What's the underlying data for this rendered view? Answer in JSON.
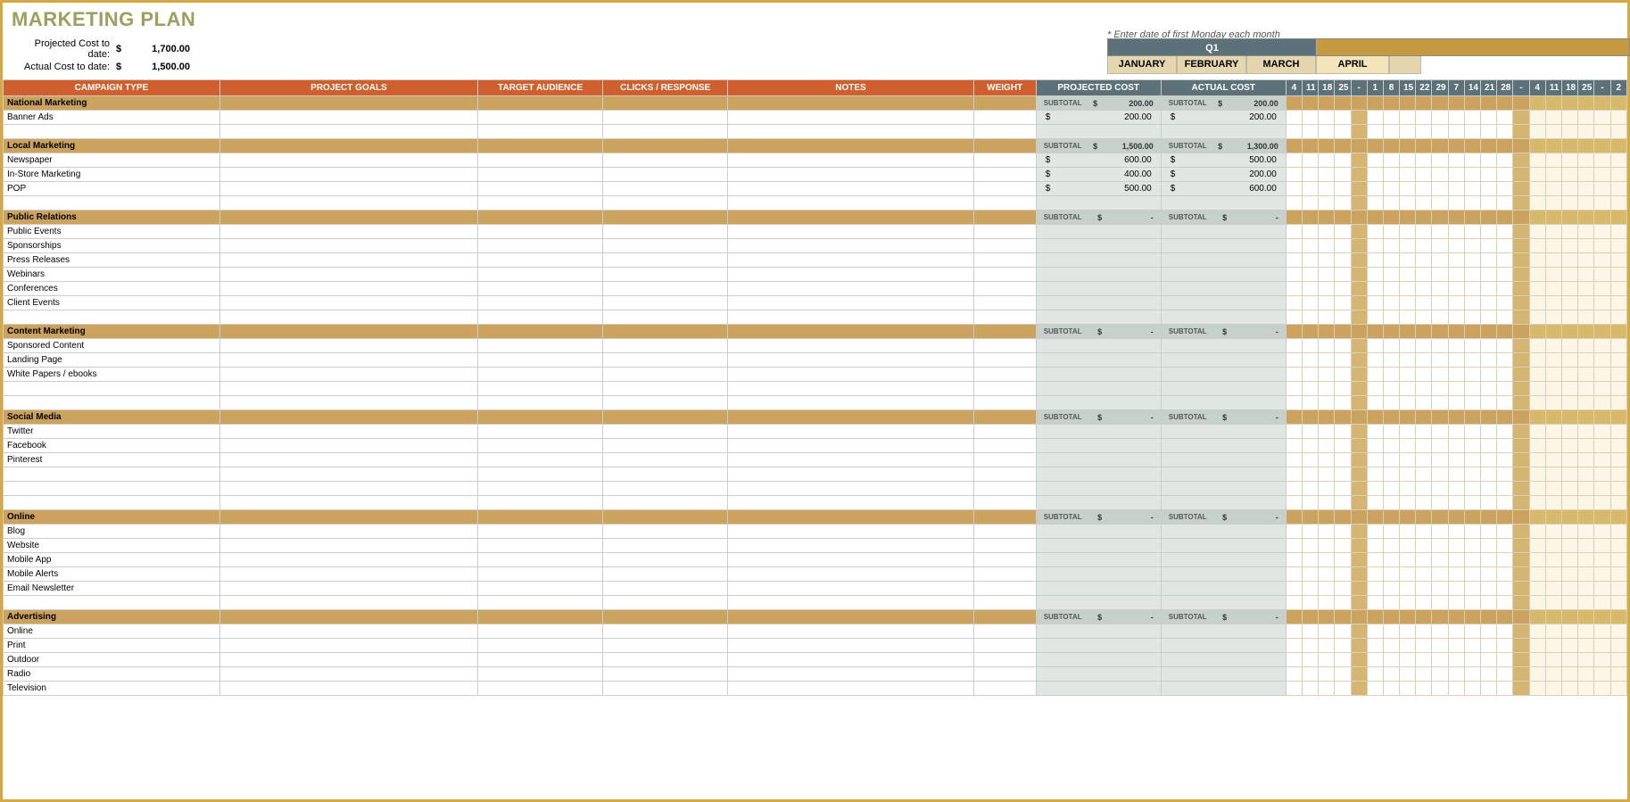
{
  "title": "MARKETING PLAN",
  "meta": {
    "proj_label": "Projected Cost to date:",
    "proj_cur": "$",
    "proj_amt": "1,700.00",
    "act_label": "Actual Cost to date:",
    "act_cur": "$",
    "act_amt": "1,500.00"
  },
  "note": "* Enter date of first Monday each month",
  "calendar": {
    "q1": "Q1",
    "months": [
      "JANUARY",
      "FEBRUARY",
      "MARCH",
      "APRIL"
    ],
    "dates": [
      "4",
      "11",
      "18",
      "25",
      "-",
      "1",
      "8",
      "15",
      "22",
      "29",
      "7",
      "14",
      "21",
      "28",
      "-",
      "4",
      "11",
      "18",
      "25",
      "-",
      "2"
    ]
  },
  "headers": {
    "campaign": "CAMPAIGN TYPE",
    "goals": "PROJECT GOALS",
    "audience": "TARGET AUDIENCE",
    "clicks": "CLICKS / RESPONSE",
    "notes": "NOTES",
    "weight": "WEIGHT",
    "projected": "PROJECTED COST",
    "actual": "ACTUAL COST"
  },
  "subtotal_label": "SUBTOTAL",
  "cur": "$",
  "dash": "-",
  "categories": [
    {
      "name": "National Marketing",
      "proj": "200.00",
      "act": "200.00",
      "items": [
        {
          "name": "Banner Ads",
          "proj": "200.00",
          "act": "200.00"
        },
        {
          "name": ""
        }
      ]
    },
    {
      "name": "Local Marketing",
      "proj": "1,500.00",
      "act": "1,300.00",
      "items": [
        {
          "name": "Newspaper",
          "proj": "600.00",
          "act": "500.00"
        },
        {
          "name": "In-Store Marketing",
          "proj": "400.00",
          "act": "200.00"
        },
        {
          "name": "POP",
          "proj": "500.00",
          "act": "600.00"
        },
        {
          "name": ""
        }
      ]
    },
    {
      "name": "Public Relations",
      "proj": "-",
      "act": "-",
      "items": [
        {
          "name": "Public Events"
        },
        {
          "name": "Sponsorships"
        },
        {
          "name": "Press Releases"
        },
        {
          "name": "Webinars"
        },
        {
          "name": "Conferences"
        },
        {
          "name": "Client Events"
        },
        {
          "name": ""
        }
      ]
    },
    {
      "name": "Content Marketing",
      "proj": "-",
      "act": "-",
      "items": [
        {
          "name": "Sponsored Content"
        },
        {
          "name": "Landing Page"
        },
        {
          "name": "White Papers / ebooks"
        },
        {
          "name": ""
        },
        {
          "name": ""
        }
      ]
    },
    {
      "name": "Social Media",
      "proj": "-",
      "act": "-",
      "items": [
        {
          "name": "Twitter"
        },
        {
          "name": "Facebook"
        },
        {
          "name": "Pinterest"
        },
        {
          "name": ""
        },
        {
          "name": ""
        },
        {
          "name": ""
        }
      ]
    },
    {
      "name": "Online",
      "proj": "-",
      "act": "-",
      "items": [
        {
          "name": "Blog"
        },
        {
          "name": "Website"
        },
        {
          "name": "Mobile App"
        },
        {
          "name": "Mobile Alerts"
        },
        {
          "name": "Email Newsletter"
        },
        {
          "name": ""
        }
      ]
    },
    {
      "name": "Advertising",
      "proj": "-",
      "act": "-",
      "items": [
        {
          "name": "Online"
        },
        {
          "name": "Print"
        },
        {
          "name": "Outdoor"
        },
        {
          "name": "Radio"
        },
        {
          "name": "Television"
        }
      ]
    }
  ]
}
